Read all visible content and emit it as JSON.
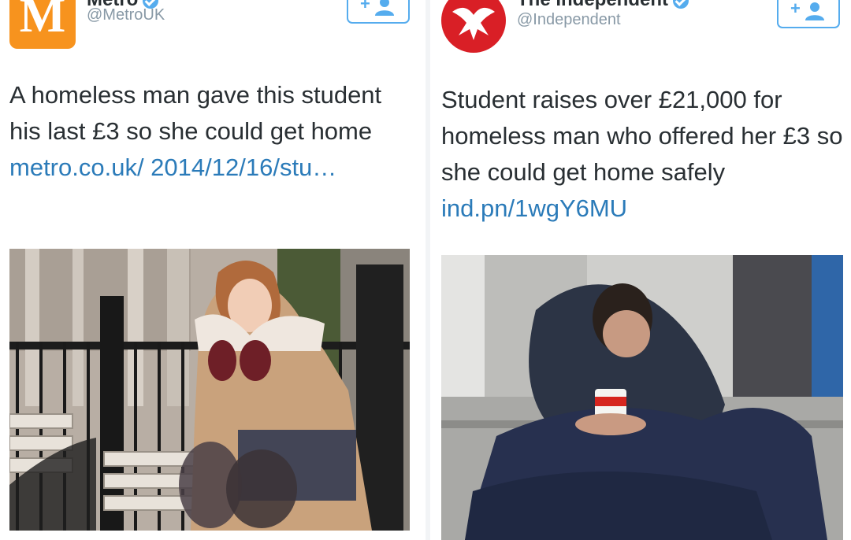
{
  "tweets": [
    {
      "account_name": "Metro",
      "handle": "@MetroUK",
      "avatar_letter": "M",
      "text": "A homeless man gave this student his last £3 so she could get home",
      "link_text": "metro.co.uk/ 2014/12/16/stu…",
      "photo_icon": "student-on-bench-photo"
    },
    {
      "account_name": "The Independent",
      "handle": "@Independent",
      "text": "Student raises over £21,000 for homeless man who offered her £3 so she could get home safely",
      "link_text": "ind.pn/1wgY6MU",
      "photo_icon": "homeless-man-photo"
    }
  ],
  "colors": {
    "metro_brand": "#f7931e",
    "independent_brand": "#d91f26",
    "link": "#2b7bb9",
    "follow_accent": "#55acee",
    "handle_gray": "#8899a6"
  }
}
